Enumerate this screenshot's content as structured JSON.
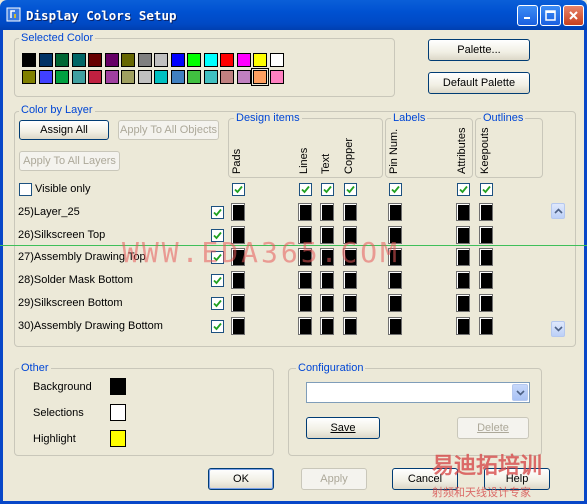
{
  "window": {
    "title": "Display Colors Setup"
  },
  "selected_color": {
    "label": "Selected Color",
    "row1": [
      "#000000",
      "#003366",
      "#006633",
      "#006666",
      "#660000",
      "#660066",
      "#666600",
      "#808080",
      "#c0c0c0",
      "#0000ff",
      "#00ff00",
      "#00ffff",
      "#ff0000",
      "#ff00ff",
      "#ffff00",
      "#ffffff"
    ],
    "row2": [
      "#808000",
      "#4040ff",
      "#00a040",
      "#40a0a0",
      "#c02040",
      "#a040a0",
      "#a0a060",
      "#c0c0c0",
      "#00c0c0",
      "#4080c0",
      "#40c040",
      "#40c0c0",
      "#c08080",
      "#c080c0",
      "#ffa060",
      "#ff80c0"
    ],
    "selected_index_row2": 14
  },
  "buttons": {
    "palette": "Palette...",
    "default_palette": "Default Palette",
    "assign_all": "Assign All",
    "apply_to_all_objects": "Apply To All Objects",
    "apply_to_all_layers": "Apply To All Layers",
    "save": "Save",
    "delete": "Delete",
    "ok": "OK",
    "apply": "Apply",
    "cancel": "Cancel",
    "help": "Help"
  },
  "color_by_layer": {
    "label": "Color by Layer",
    "design_items_label": "Design items",
    "labels_label": "Labels",
    "outlines_label": "Outlines",
    "columns": [
      "Pads",
      "Lines",
      "Text",
      "Copper",
      "Pin Num.",
      "Attributes",
      "Keepouts"
    ],
    "visible_only": "Visible only",
    "layers": [
      {
        "name": "25)Layer_25"
      },
      {
        "name": "26)Silkscreen Top"
      },
      {
        "name": "27)Assembly Drawing Top"
      },
      {
        "name": "28)Solder Mask Bottom"
      },
      {
        "name": "29)Silkscreen Bottom"
      },
      {
        "name": "30)Assembly Drawing Bottom"
      }
    ]
  },
  "other": {
    "label": "Other",
    "items": [
      {
        "label": "Background",
        "color": "#000000"
      },
      {
        "label": "Selections",
        "color": "#ffffff"
      },
      {
        "label": "Highlight",
        "color": "#ffff00"
      }
    ]
  },
  "configuration": {
    "label": "Configuration",
    "value": ""
  },
  "watermark": {
    "text": "WWW.EDA365.COM",
    "corner_main": "易迪拓培训",
    "corner_sub": "射频和天线设计专家"
  }
}
